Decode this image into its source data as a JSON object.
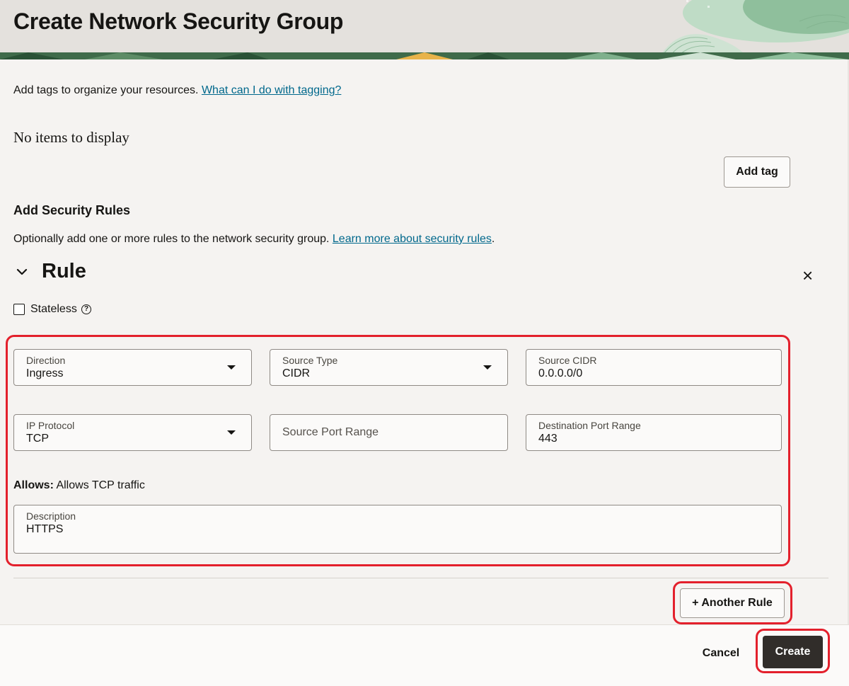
{
  "header": {
    "title": "Create Network Security Group"
  },
  "tags": {
    "intro_text": "Add tags to organize your resources.",
    "help_link": "What can I do with tagging?",
    "empty_text": "No items to display",
    "add_tag_button": "Add tag"
  },
  "security_rules": {
    "heading": "Add Security Rules",
    "intro_text": "Optionally add one or more rules to the network security group.",
    "learn_more_link": "Learn more about security rules",
    "period": "."
  },
  "rule": {
    "title": "Rule",
    "stateless_label": "Stateless",
    "help_glyph": "?",
    "close_glyph": "×",
    "direction": {
      "label": "Direction",
      "value": "Ingress"
    },
    "source_type": {
      "label": "Source Type",
      "value": "CIDR"
    },
    "source_cidr": {
      "label": "Source CIDR",
      "value": "0.0.0.0/0"
    },
    "ip_protocol": {
      "label": "IP Protocol",
      "value": "TCP"
    },
    "source_port_range": {
      "placeholder": "Source Port Range"
    },
    "destination_port_range": {
      "label": "Destination Port Range",
      "value": "443"
    },
    "allows_label": "Allows:",
    "allows_value": "Allows TCP traffic",
    "description": {
      "label": "Description",
      "value": "HTTPS"
    }
  },
  "another_rule_button": "+ Another Rule",
  "footer": {
    "cancel_button": "Cancel",
    "create_button": "Create"
  },
  "colors": {
    "highlight": "#e3202c",
    "link": "#00688c",
    "primary_button": "#312d2a"
  }
}
